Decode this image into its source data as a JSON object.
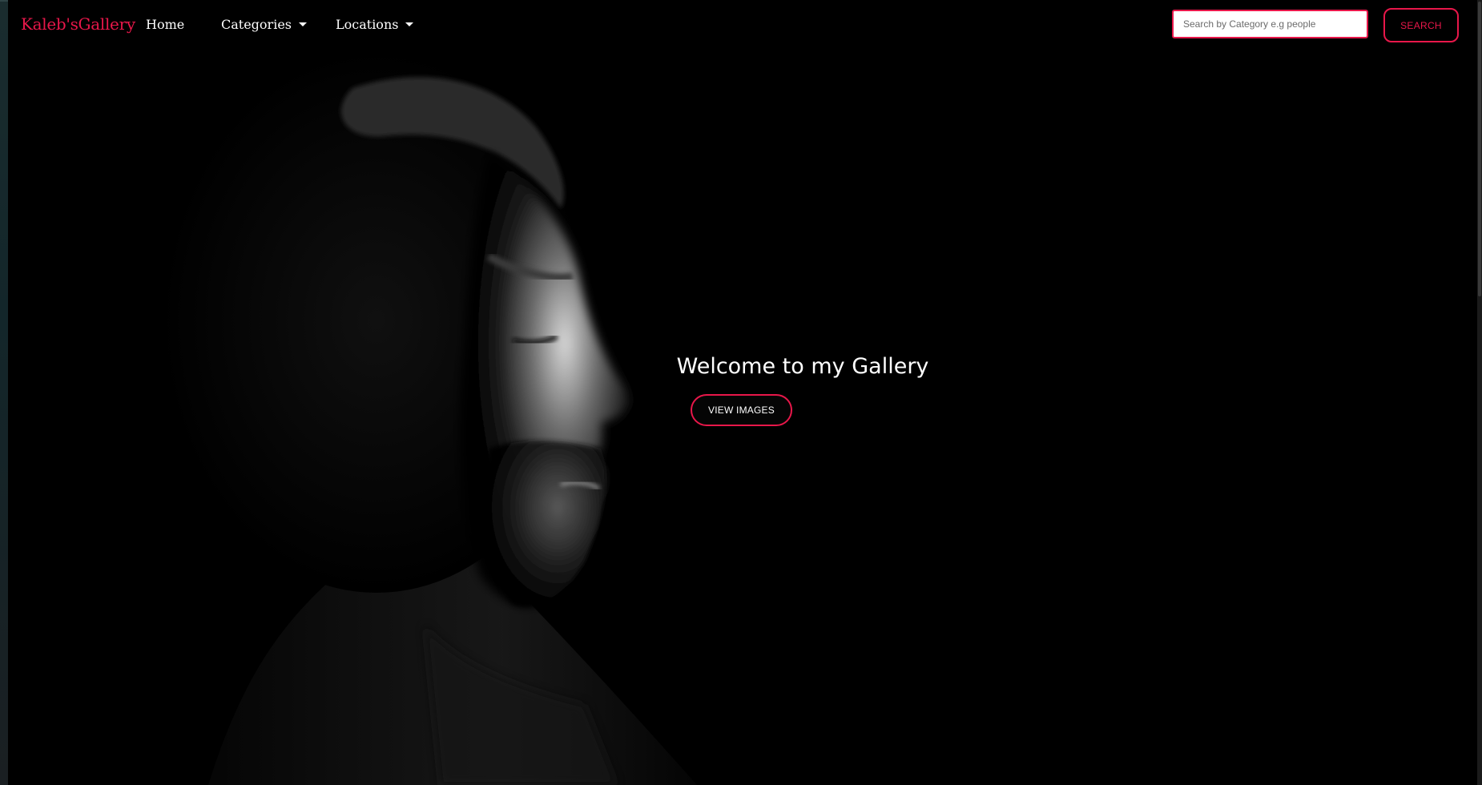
{
  "navbar": {
    "brand": "Kaleb'sGallery",
    "home": "Home",
    "categories": "Categories",
    "locations": "Locations",
    "search_placeholder": "Search by Category e.g people",
    "search_value": "",
    "search_button": "SEARCH"
  },
  "hero": {
    "title": "Welcome to my Gallery",
    "button": "VIEW IMAGES",
    "image_icon": "man-profile-portrait"
  },
  "colors": {
    "accent": "#e8174a",
    "background": "#000000",
    "text": "#ffffff"
  }
}
